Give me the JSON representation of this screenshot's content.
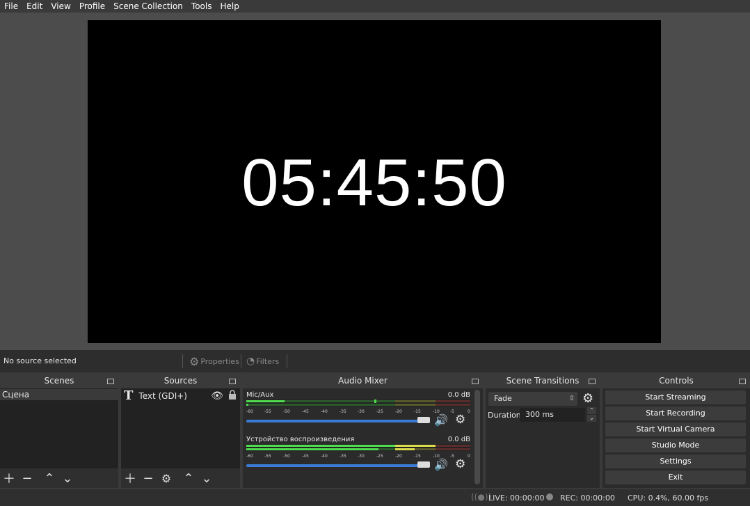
{
  "menu": [
    "File",
    "Edit",
    "View",
    "Profile",
    "Scene Collection",
    "Tools",
    "Help"
  ],
  "preview": {
    "clock_text": "05:45:50"
  },
  "source_bar": {
    "status": "No source selected",
    "properties_label": "Properties",
    "filters_label": "Filters"
  },
  "scenes": {
    "title": "Scenes",
    "items": [
      "Сцена"
    ]
  },
  "sources": {
    "title": "Sources",
    "items": [
      {
        "icon": "text-icon",
        "label": "Text (GDI+)"
      }
    ]
  },
  "mixer": {
    "title": "Audio Mixer",
    "scale": [
      "-60",
      "-55",
      "-50",
      "-45",
      "-40",
      "-35",
      "-30",
      "-25",
      "-20",
      "-15",
      "-10",
      "-5",
      "0"
    ],
    "channels": [
      {
        "name": "Mic/Aux",
        "db": "0.0 dB",
        "volume": 1.0
      },
      {
        "name": "Устройство воспроизведения",
        "db": "0.0 dB",
        "volume": 1.0
      }
    ]
  },
  "transitions": {
    "title": "Scene Transitions",
    "selected": "Fade",
    "duration_label": "Duration",
    "duration_value": "300 ms"
  },
  "controls": {
    "title": "Controls",
    "buttons": [
      "Start Streaming",
      "Start Recording",
      "Start Virtual Camera",
      "Studio Mode",
      "Settings",
      "Exit"
    ]
  },
  "status": {
    "live": "LIVE: 00:00:00",
    "rec": "REC: 00:00:00",
    "cpu": "CPU: 0.4%, 60.00 fps"
  },
  "colors": {
    "meter_green": "#3fb83f",
    "meter_yellow": "#b8b83f",
    "meter_red": "#b83f3f",
    "accent": "#3a7bd5"
  }
}
